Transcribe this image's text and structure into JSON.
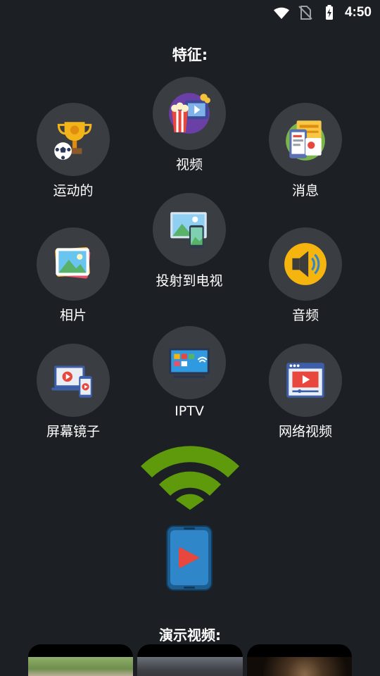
{
  "status_bar": {
    "time": "4:50",
    "icons": [
      "wifi-icon",
      "no-sim-icon",
      "battery-charging-icon"
    ]
  },
  "features": {
    "title": "特征:",
    "items": [
      {
        "label": "运动的",
        "icon": "sports-trophy-icon"
      },
      {
        "label": "视频",
        "icon": "video-popcorn-icon"
      },
      {
        "label": "消息",
        "icon": "messages-icon"
      },
      {
        "label": "相片",
        "icon": "photos-icon"
      },
      {
        "label": "投射到电视",
        "icon": "cast-to-tv-icon"
      },
      {
        "label": "音频",
        "icon": "audio-speaker-icon"
      },
      {
        "label": "屏幕镜子",
        "icon": "screen-mirror-icon"
      },
      {
        "label": "IPTV",
        "icon": "iptv-icon"
      },
      {
        "label": "网络视频",
        "icon": "web-video-icon"
      }
    ]
  },
  "demo": {
    "title": "演示视频:"
  },
  "colors": {
    "background": "#1c2025",
    "circle": "#3a3d42",
    "wifi_green": "#5f9a0c",
    "phone_blue": "#2f86c9"
  }
}
